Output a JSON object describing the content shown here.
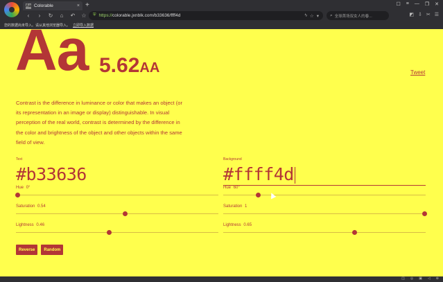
{
  "browser": {
    "tab_favicon": "Aa",
    "tab_title": "Colorable",
    "new_tab": "+",
    "url_scheme": "https://",
    "url_host": "colorable.jxnblk.com",
    "url_path": "/b33636/ffff4d",
    "search_text": "全球首场双女人的春...",
    "bookmark_text": "您的数据尚未导入。请从其他浏览器导入。",
    "bookmark_link": "立即导入数据"
  },
  "page": {
    "aa": "Aa",
    "ratio": "5.62",
    "grade": "AA",
    "tweet": "Tweet",
    "description": "Contrast is the difference in luminance or color that makes an object (or its representation in an image or display) distinguishable. In visual perception of the real world, contrast is determined by the difference in the color and brightness of the object and other objects within the same field of view.",
    "text": {
      "label": "Text",
      "hex": "#b33636",
      "hue": {
        "label": "Hue",
        "value": "0°",
        "level": 0
      },
      "saturation": {
        "label": "Saturation",
        "value": "0.54",
        "level": 0.54
      },
      "lightness": {
        "label": "Lightness",
        "value": "0.46",
        "level": 0.46
      }
    },
    "background": {
      "label": "Background",
      "hex": "#ffff4d",
      "hue": {
        "label": "Hue",
        "value": "60°",
        "level": 0.1667
      },
      "saturation": {
        "label": "Saturation",
        "value": "1",
        "level": 1
      },
      "lightness": {
        "label": "Lightness",
        "value": "0.65",
        "level": 0.65
      }
    },
    "buttons": {
      "reverse": "Reverse",
      "random": "Random"
    }
  },
  "colors": {
    "text": "#b33636",
    "background": "#ffff4d",
    "chrome": "#2f2f33"
  },
  "icons": [
    "back-icon",
    "forward-icon",
    "reload-icon",
    "home-icon",
    "undo-icon",
    "bookmark-star-icon",
    "shield-icon",
    "search-icon",
    "menu-icon"
  ]
}
